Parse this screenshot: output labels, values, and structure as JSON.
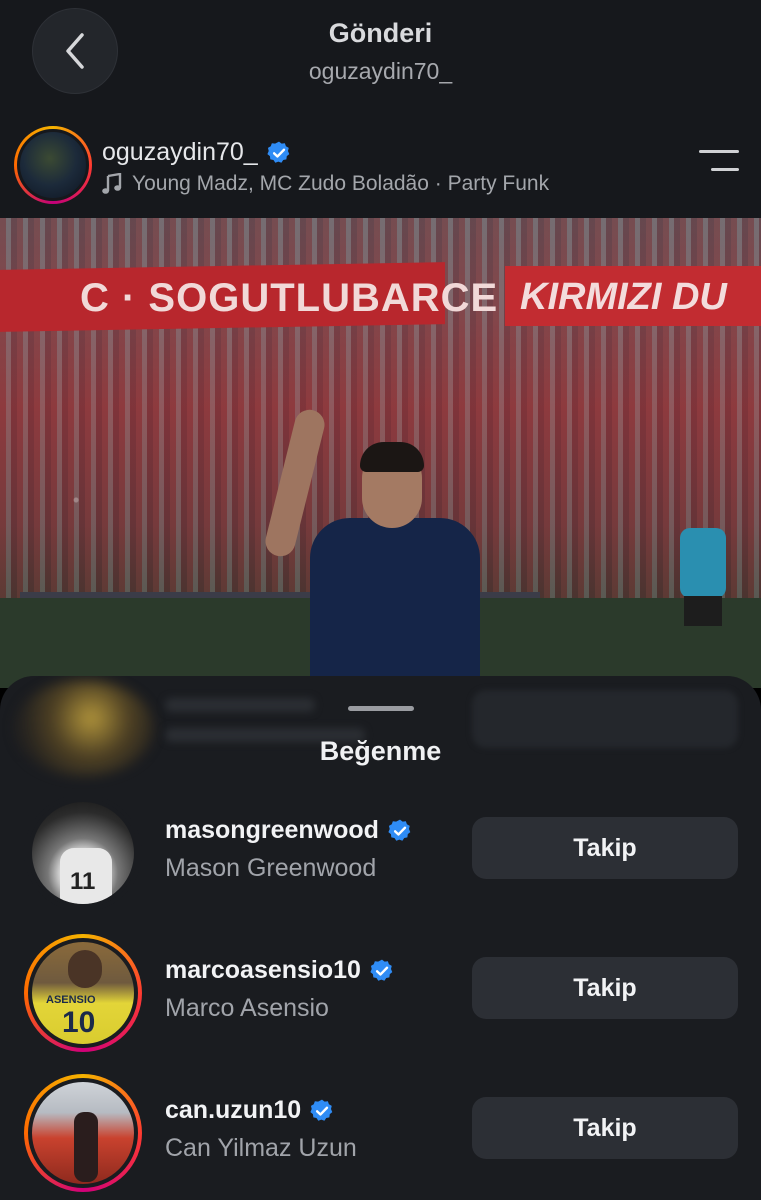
{
  "header": {
    "title": "Gönderi",
    "subtitle": "oguzaydin70_"
  },
  "post": {
    "author": "oguzaydin70_",
    "music": "Young Madz, MC Zudo Boladão · Party Funk",
    "photo_texts": {
      "banner_left": "C · SOGUTLUBARCE",
      "banner_right": "KIRMIZI DU"
    }
  },
  "likes_sheet": {
    "title": "Beğenme",
    "users": [
      {
        "username": "masongreenwood",
        "full_name": "Mason Greenwood",
        "button": "Takip",
        "avatar_number": "11"
      },
      {
        "username": "marcoasensio10",
        "full_name": "Marco Asensio",
        "button": "Takip",
        "avatar_label": "ASENSIO",
        "avatar_number": "10"
      },
      {
        "username": "can.uzun10",
        "full_name": "Can Yilmaz Uzun",
        "button": "Takip"
      }
    ]
  },
  "colors": {
    "background": "#1a1c20",
    "verified": "#2f8cf5",
    "story_ring": "#f5b300",
    "button_bg": "#2c2f35"
  },
  "icons": {
    "back": "chevron-left-icon",
    "verified": "verified-badge-icon",
    "music": "music-note-icon",
    "menu": "menu-lines-icon"
  }
}
